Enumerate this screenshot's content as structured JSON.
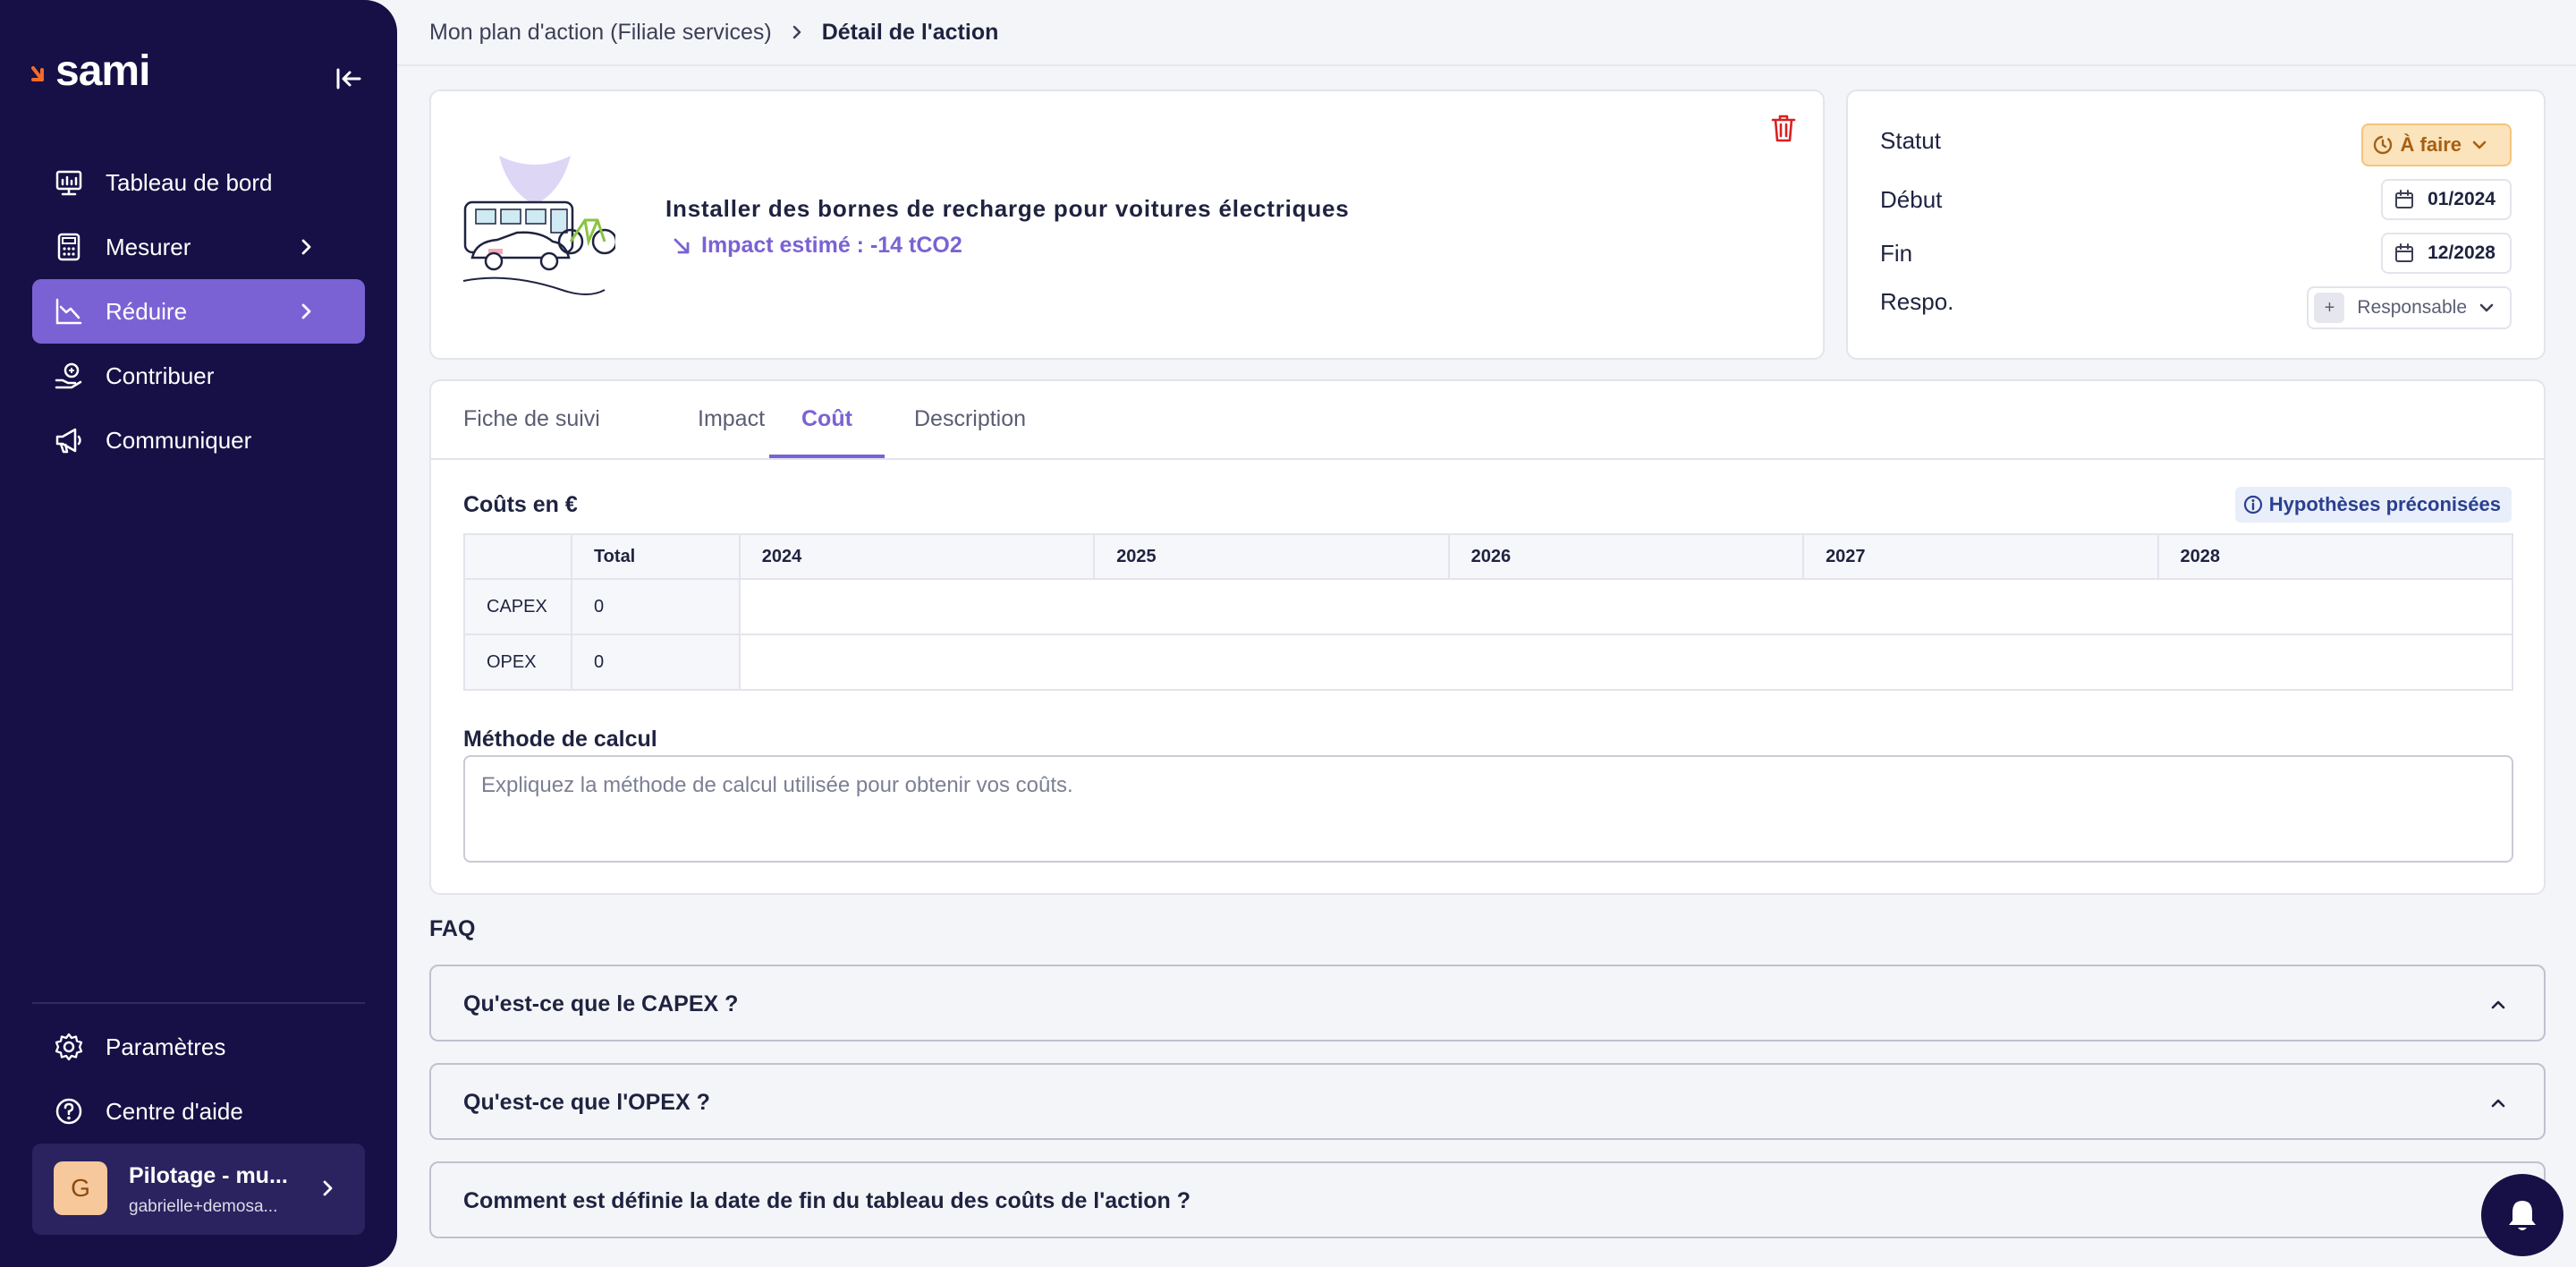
{
  "app": {
    "logo": "sami"
  },
  "sidebar": {
    "items": [
      {
        "label": "Tableau de bord",
        "icon": "dashboard-icon"
      },
      {
        "label": "Mesurer",
        "icon": "calculator-icon",
        "has_submenu": true
      },
      {
        "label": "Réduire",
        "icon": "chart-down-icon",
        "has_submenu": true,
        "active": true
      },
      {
        "label": "Contribuer",
        "icon": "hands-coin-icon"
      },
      {
        "label": "Communiquer",
        "icon": "megaphone-icon"
      }
    ],
    "bottom_items": [
      {
        "label": "Paramètres",
        "icon": "gear-icon"
      },
      {
        "label": "Centre d'aide",
        "icon": "help-circle-icon"
      }
    ],
    "account": {
      "initial": "G",
      "name": "Pilotage - mu...",
      "email": "gabrielle+demosa..."
    }
  },
  "breadcrumb": {
    "parent": "Mon plan d'action (Filiale services)",
    "current": "Détail de l'action"
  },
  "action": {
    "title": "Installer des bornes de recharge pour voitures électriques",
    "impact": "Impact estimé : -14 tCO2"
  },
  "status_panel": {
    "status_label": "Statut",
    "status_value": "À faire",
    "start_label": "Début",
    "start_value": "01/2024",
    "end_label": "Fin",
    "end_value": "12/2028",
    "resp_label": "Respo.",
    "resp_plus": "+",
    "resp_value": "Responsable"
  },
  "tabs": [
    "Fiche de suivi",
    "Impact",
    "Coût",
    "Description"
  ],
  "active_tab": "Coût",
  "costs": {
    "title": "Coûts en €",
    "hypotheses_label": "Hypothèses préconisées",
    "headers": [
      "",
      "Total",
      "2024",
      "2025",
      "2026",
      "2027",
      "2028"
    ],
    "rows": [
      {
        "label": "CAPEX",
        "total": "0"
      },
      {
        "label": "OPEX",
        "total": "0"
      }
    ]
  },
  "method": {
    "title": "Méthode de calcul",
    "placeholder": "Expliquez la méthode de calcul utilisée pour obtenir vos coûts."
  },
  "faq": {
    "title": "FAQ",
    "items": [
      "Qu'est-ce que le CAPEX ?",
      "Qu'est-ce que l'OPEX ?",
      "Comment est définie la date de fin du tableau des coûts de l'action ?"
    ]
  },
  "colors": {
    "sidebar_bg": "#161046",
    "accent": "#7b62d4",
    "status_bg": "#fbe3bc",
    "status_text": "#a75f12",
    "danger": "#d92020"
  }
}
